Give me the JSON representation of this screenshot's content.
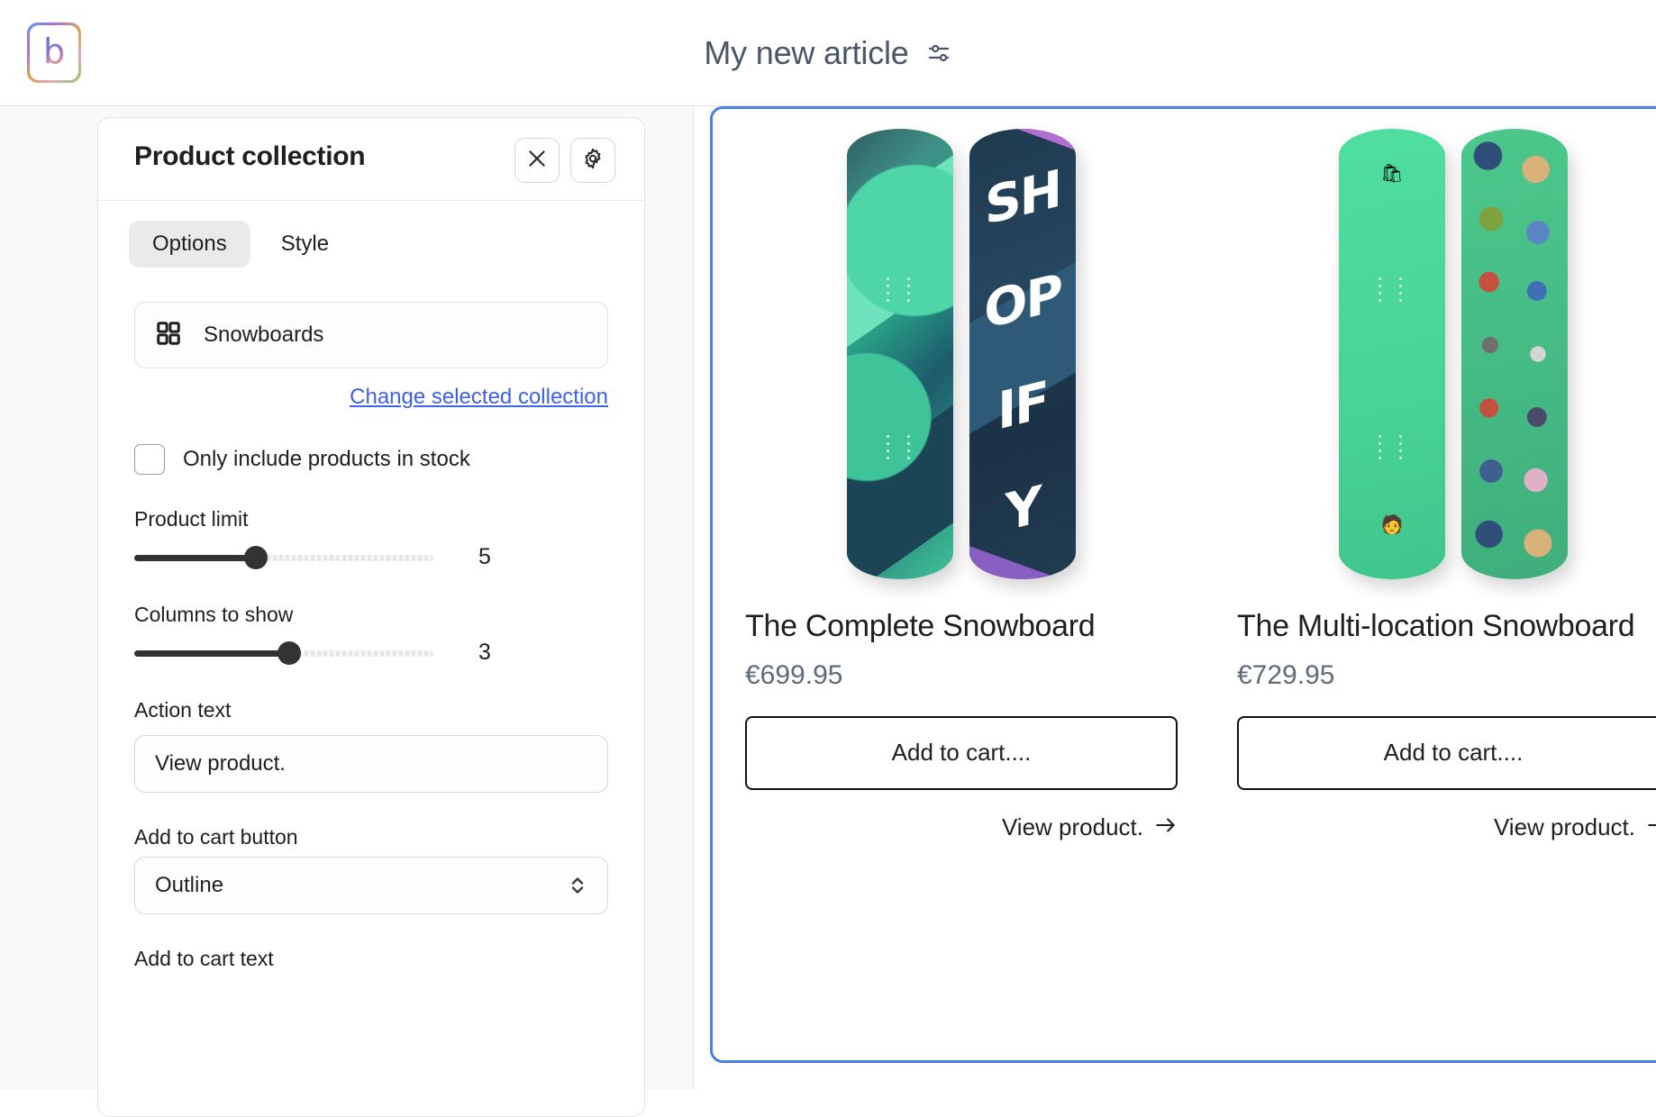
{
  "header": {
    "logo_letter": "b",
    "document_title": "My new article",
    "settings_icon": "sliders-icon"
  },
  "panel": {
    "title": "Product collection",
    "close_icon": "close-icon",
    "settings_icon": "gear-icon",
    "tabs": [
      {
        "label": "Options",
        "active": true
      },
      {
        "label": "Style",
        "active": false
      }
    ],
    "collection": {
      "icon": "grid-icon",
      "value": "Snowboards",
      "change_link": "Change selected collection"
    },
    "in_stock": {
      "label": "Only include products in stock",
      "checked": false
    },
    "product_limit": {
      "label": "Product limit",
      "value": "5",
      "fill_percent": 40
    },
    "columns_to_show": {
      "label": "Columns to show",
      "value": "3",
      "fill_percent": 52
    },
    "action_text": {
      "label": "Action text",
      "value": "View product.",
      "placeholder": "View product."
    },
    "add_to_cart_button": {
      "label": "Add to cart button",
      "value": "Outline"
    },
    "add_to_cart_text": {
      "label": "Add to cart text"
    }
  },
  "preview": {
    "products": [
      {
        "title": "The Complete Snowboard",
        "price": "€699.95",
        "cart_label": "Add to cart....",
        "view_label": "View product.",
        "board_left": "teal-geometric-snowboard",
        "board_right": "shopify-text-snowboard",
        "board_right_text": [
          "SH",
          "OP",
          "IF",
          "Y"
        ],
        "board_badge_top": "",
        "board_badge_bottom": ""
      },
      {
        "title": "The Multi-location Snowboard",
        "price": "€729.95",
        "cart_label": "Add to cart....",
        "view_label": "View product.",
        "board_left": "green-shopify-bag-snowboard",
        "board_right": "green-pixel-people-snowboard",
        "board_right_text": [],
        "board_badge_top": "🛍",
        "board_badge_bottom": "🧑"
      }
    ]
  },
  "colors": {
    "accent_link": "#3f62e8",
    "selection_border": "#4a80e0",
    "sidebar_bg": "#f9f9f9",
    "price_text": "#5f6b7a"
  }
}
